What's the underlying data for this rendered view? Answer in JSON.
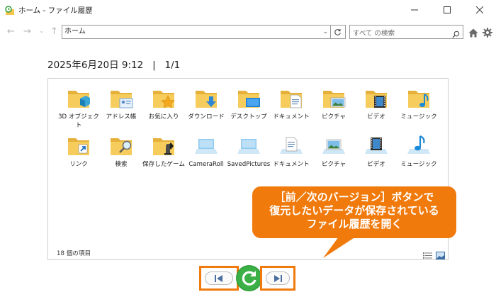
{
  "window": {
    "title": "ホーム - ファイル履歴",
    "minimize_label": "—",
    "maximize_label": "☐",
    "close_label": "✕"
  },
  "nav": {
    "address": "ホーム",
    "search_placeholder": "すべて の検索"
  },
  "snapshot": {
    "date_line": "2025年6月20日 9:12   |   1/1"
  },
  "items": [
    {
      "label": "3D オブジェクト",
      "icon": "3d-objects-folder-icon"
    },
    {
      "label": "アドレス帳",
      "icon": "contacts-folder-icon"
    },
    {
      "label": "お気に入り",
      "icon": "favorites-folder-icon"
    },
    {
      "label": "ダウンロード",
      "icon": "downloads-folder-icon"
    },
    {
      "label": "デスクトップ",
      "icon": "desktop-folder-icon"
    },
    {
      "label": "ドキュメント",
      "icon": "documents-folder-icon"
    },
    {
      "label": "ピクチャ",
      "icon": "pictures-folder-icon"
    },
    {
      "label": "ビデオ",
      "icon": "videos-folder-icon"
    },
    {
      "label": "ミュージック",
      "icon": "music-folder-icon"
    },
    {
      "label": "リンク",
      "icon": "links-folder-icon"
    },
    {
      "label": "検索",
      "icon": "searches-folder-icon"
    },
    {
      "label": "保存したゲーム",
      "icon": "saved-games-folder-icon"
    },
    {
      "label": "CameraRoll",
      "icon": "camera-roll-library-icon"
    },
    {
      "label": "SavedPictures",
      "icon": "saved-pictures-library-icon"
    },
    {
      "label": "ドキュメント",
      "icon": "documents-library-icon"
    },
    {
      "label": "ピクチャ",
      "icon": "pictures-library-icon"
    },
    {
      "label": "ビデオ",
      "icon": "videos-library-icon"
    },
    {
      "label": "ミュージック",
      "icon": "music-library-icon"
    }
  ],
  "status": {
    "item_count": "18 個の項目"
  },
  "callout": {
    "line1": "［前／次のバージョン］ボタンで",
    "line2": "復元したいデータが保存されている",
    "line3": "ファイル履歴を開く"
  },
  "colors": {
    "accent": "#f07a0c",
    "folder": "#f4c64e",
    "restore": "#2f9e3a"
  }
}
